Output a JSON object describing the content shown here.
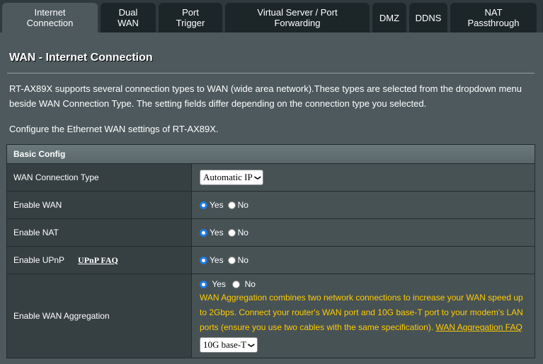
{
  "tabs": [
    {
      "label": "Internet\nConnection",
      "active": true
    },
    {
      "label": "Dual\nWAN"
    },
    {
      "label": "Port\nTrigger"
    },
    {
      "label": "Virtual Server / Port\nForwarding"
    },
    {
      "label": "DMZ"
    },
    {
      "label": "DDNS"
    },
    {
      "label": "NAT\nPassthrough"
    }
  ],
  "page": {
    "title": "WAN - Internet Connection",
    "description": "RT-AX89X supports several connection types to WAN (wide area network).These types are selected from the dropdown menu beside WAN Connection Type. The setting fields differ depending on the connection type you selected.",
    "subdescription": "Configure the Ethernet WAN settings of RT-AX89X."
  },
  "basic_config": {
    "header": "Basic Config",
    "wan_connection_type": {
      "label": "WAN Connection Type",
      "value": "Automatic IP"
    },
    "enable_wan": {
      "label": "Enable WAN",
      "yes": "Yes",
      "no": "No",
      "selected": "yes"
    },
    "enable_nat": {
      "label": "Enable NAT",
      "yes": "Yes",
      "no": "No",
      "selected": "yes"
    },
    "enable_upnp": {
      "label": "Enable UPnP",
      "faq": "UPnP FAQ",
      "yes": "Yes",
      "no": "No",
      "selected": "yes"
    },
    "enable_wan_aggregation": {
      "label": "Enable WAN Aggregation",
      "yes": "Yes",
      "no": "No",
      "selected": "yes",
      "note": "WAN Aggregation combines two network connections to increase your WAN speed up to 2Gbps. Connect your router's WAN port and 10G base-T port to your modem's LAN ports (ensure you use two cables with the same specification).",
      "faq": "WAN Aggregation FAQ",
      "port_value": "10G base-T"
    }
  },
  "colors": {
    "background": "#4d595d",
    "tab_inactive": "#1c2629",
    "warning_text": "#ffcc00",
    "radio_selected": "#1f7be0"
  }
}
